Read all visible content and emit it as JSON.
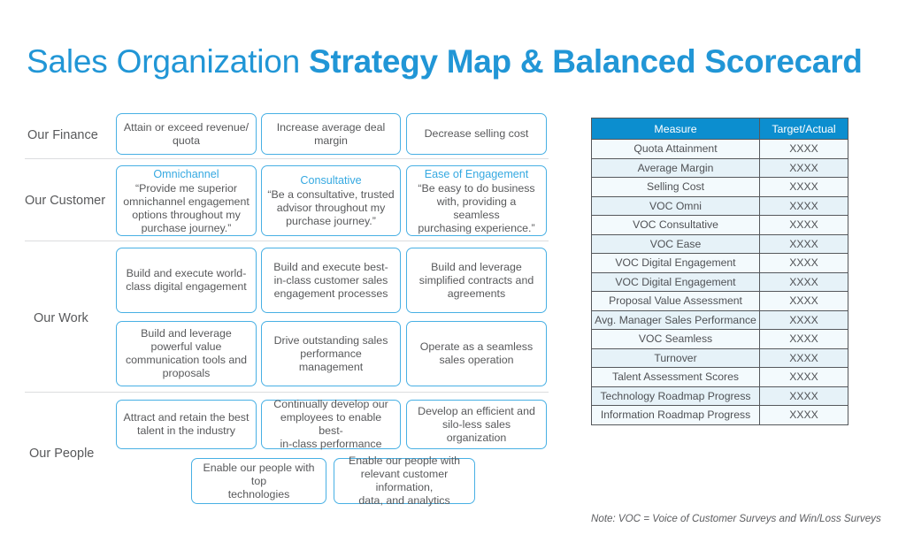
{
  "title": {
    "light": "Sales Organization ",
    "bold": "Strategy Map & Balanced Scorecard",
    "color": "#2196d6"
  },
  "colors": {
    "accent_blue": "#2196d6",
    "box_border": "#48b0e4",
    "headline_blue": "#36a9e1",
    "table_header_bg": "#0c8ecf",
    "row_odd": "#f3fafd",
    "row_even": "#e6f2f8",
    "body_text": "#58595b",
    "divider": "#dcdddf"
  },
  "perspectives": [
    {
      "label": "Our Finance"
    },
    {
      "label": "Our Customer"
    },
    {
      "label": "Our Work"
    },
    {
      "label": "Our People"
    }
  ],
  "finance": {
    "boxes": [
      {
        "body": "Attain or exceed revenue/\nquota"
      },
      {
        "body": "Increase average deal\nmargin"
      },
      {
        "body": "Decrease selling cost"
      }
    ]
  },
  "customer": {
    "boxes": [
      {
        "headline": "Omnichannel",
        "body": "“Provide me superior\nomnichannel engagement\noptions throughout my\npurchase journey.”"
      },
      {
        "headline": "Consultative",
        "body": "“Be a consultative, trusted\nadvisor throughout my\npurchase journey.”"
      },
      {
        "headline": "Ease of Engagement",
        "body": "“Be easy to do business\nwith, providing a seamless\npurchasing experience.”"
      }
    ]
  },
  "work": {
    "row1": [
      {
        "body": "Build and execute world-\nclass digital engagement"
      },
      {
        "body": "Build and execute best-\nin-class customer sales\nengagement processes"
      },
      {
        "body": "Build and leverage\nsimplified contracts and\nagreements"
      }
    ],
    "row2": [
      {
        "body": "Build and leverage\npowerful  value\ncommunication tools and\nproposals"
      },
      {
        "body": "Drive outstanding sales\nperformance management"
      },
      {
        "body": "Operate as a seamless\nsales operation"
      }
    ]
  },
  "people": {
    "row1": [
      {
        "body": "Attract and retain the best\ntalent in the industry"
      },
      {
        "body": "Continually develop our\nemployees to enable best-\nin-class performance"
      },
      {
        "body": "Develop an efficient and\nsilo-less sales organization"
      }
    ],
    "row2": [
      {
        "body": "Enable our people with top\ntechnologies"
      },
      {
        "body": "Enable our people with\nrelevant customer information,\ndata, and analytics"
      }
    ]
  },
  "scorecard": {
    "headers": [
      "Measure",
      "Target/Actual"
    ],
    "rows": [
      {
        "measure": "Quota Attainment",
        "target": "XXXX"
      },
      {
        "measure": "Average Margin",
        "target": "XXXX"
      },
      {
        "measure": "Selling Cost",
        "target": "XXXX"
      },
      {
        "measure": "VOC Omni",
        "target": "XXXX"
      },
      {
        "measure": "VOC Consultative",
        "target": "XXXX"
      },
      {
        "measure": "VOC Ease",
        "target": "XXXX"
      },
      {
        "measure": "VOC Digital Engagement",
        "target": "XXXX"
      },
      {
        "measure": "VOC Digital Engagement",
        "target": "XXXX"
      },
      {
        "measure": "Proposal Value Assessment",
        "target": "XXXX"
      },
      {
        "measure": "Avg. Manager Sales Performance",
        "target": "XXXX"
      },
      {
        "measure": "VOC Seamless",
        "target": "XXXX"
      },
      {
        "measure": "Turnover",
        "target": "XXXX"
      },
      {
        "measure": "Talent Assessment Scores",
        "target": "XXXX"
      },
      {
        "measure": "Technology Roadmap Progress",
        "target": "XXXX"
      },
      {
        "measure": "Information Roadmap Progress",
        "target": "XXXX"
      }
    ],
    "note": "Note: VOC = Voice of Customer Surveys and Win/Loss Surveys"
  }
}
